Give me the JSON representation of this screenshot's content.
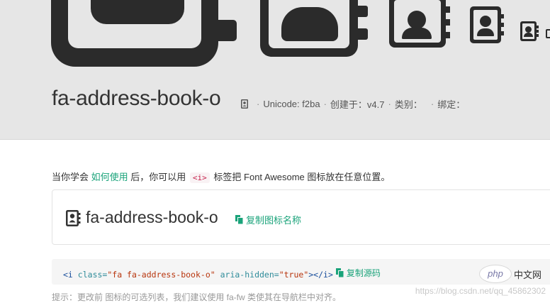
{
  "icon": {
    "name": "fa-address-book-o",
    "semantic": "address-book-icon"
  },
  "meta": {
    "unicode": "Unicode: f2ba",
    "created": "创建于：v4.7",
    "category": "类别：",
    "alias": "绑定："
  },
  "intro": {
    "prefix": "当你学会",
    "link": "如何使用",
    "middle": "后，你可以用",
    "tag": "<i>",
    "suffix": "标签把 Font Awesome 图标放在任意位置。"
  },
  "demo": {
    "copy_label": "复制图标名称"
  },
  "code": {
    "open_tag": "<i",
    "attr_class": "class=",
    "val_class": "\"fa fa-address-book-o\"",
    "attr_aria": "aria-hidden=",
    "val_aria": "\"true\"",
    "close": "></i>",
    "copy_label": "复制源码"
  },
  "footer_partial": "提示：更改前 图标的可选列表，我们建议使用 fa-fw 类使其在导航栏中对齐。",
  "watermark": "https://blog.csdn.net/qq_45862302",
  "badge": {
    "php": "php",
    "cn": "中文网"
  },
  "colors": {
    "hero_bg": "#e6e6e6",
    "icon_dark": "#2b2b2b",
    "accent": "#1aa37a"
  }
}
